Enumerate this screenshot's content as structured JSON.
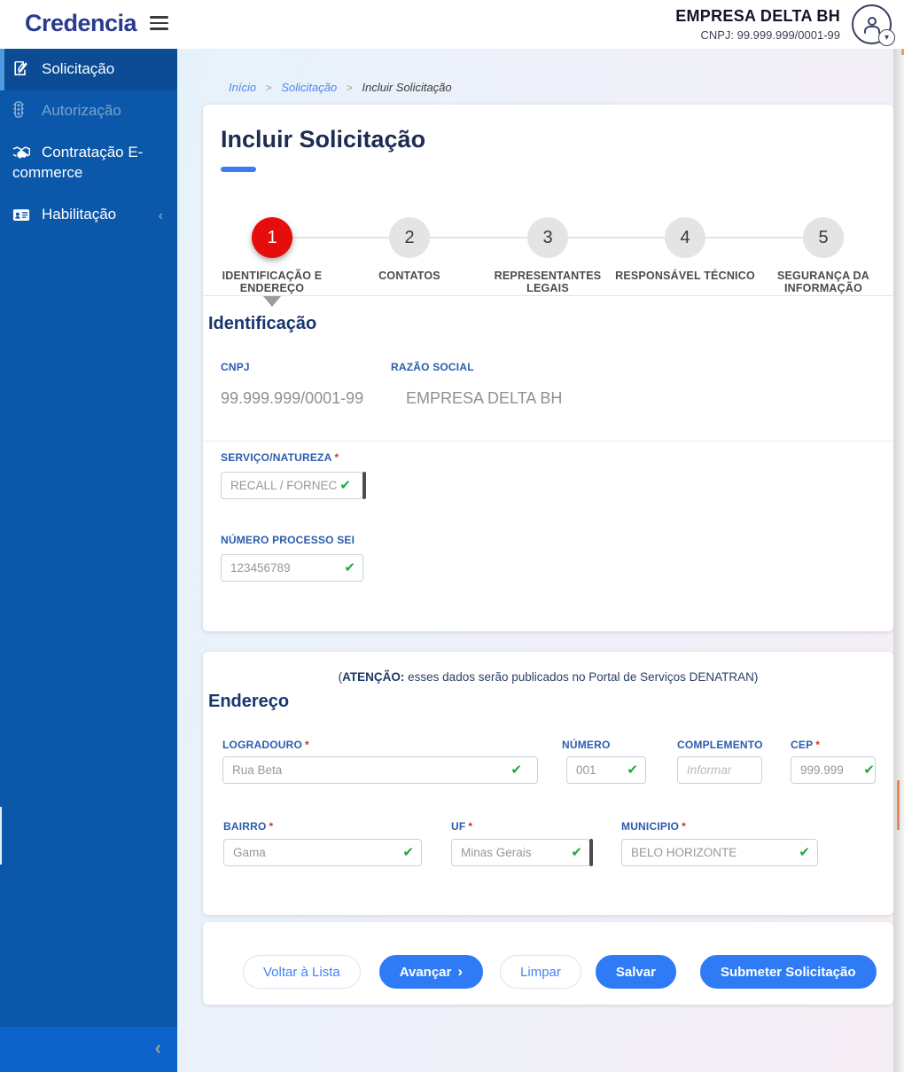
{
  "header": {
    "logo": "Credencia",
    "company_name": "EMPRESA DELTA BH",
    "company_cnpj": "CNPJ: 99.999.999/0001-99"
  },
  "sidebar": {
    "items": [
      {
        "label": "Solicitação",
        "state": "active"
      },
      {
        "label": "Autorização",
        "state": "disabled"
      },
      {
        "label": "Contratação E-commerce",
        "state": "normal"
      },
      {
        "label": "Habilitação",
        "state": "normal"
      }
    ]
  },
  "breadcrumb": {
    "items": [
      "Início",
      "Solicitação",
      "Incluir Solicitação"
    ],
    "separator": ">"
  },
  "page": {
    "title": "Incluir Solicitação"
  },
  "stepper": {
    "steps": [
      {
        "number": "1",
        "label": "IDENTIFICAÇÃO E ENDEREÇO",
        "active": true
      },
      {
        "number": "2",
        "label": "CONTATOS",
        "active": false
      },
      {
        "number": "3",
        "label": "REPRESENTANTES LEGAIS",
        "active": false
      },
      {
        "number": "4",
        "label": "RESPONSÁVEL TÉCNICO",
        "active": false
      },
      {
        "number": "5",
        "label": "SEGURANÇA DA INFORMAÇÃO",
        "active": false
      }
    ]
  },
  "identification": {
    "heading": "Identificação",
    "cnpj_label": "CNPJ",
    "cnpj_value": "99.999.999/0001-99",
    "razao_label": "RAZÃO SOCIAL",
    "razao_value": "EMPRESA DELTA BH",
    "servico_label": "SERVIÇO/NATUREZA",
    "servico_required": "*",
    "servico_value": "RECALL / FORNEC",
    "processo_label": "NÚMERO PROCESSO SEI",
    "processo_value": "123456789"
  },
  "address": {
    "note_prefix": "(",
    "note_bold": "ATENÇÃO:",
    "note_rest": " esses dados serão publicados no Portal de Serviços DENATRAN)",
    "heading": "Endereço",
    "required_mark": "*",
    "logradouro_label": "LOGRADOURO",
    "logradouro_value": "Rua Beta",
    "numero_label": "NÚMERO",
    "numero_value": "001",
    "complemento_label": "COMPLEMENTO",
    "complemento_placeholder": "Informar",
    "cep_label": "CEP",
    "cep_value": "999.999",
    "bairro_label": "BAIRRO",
    "bairro_value": "Gama",
    "uf_label": "UF",
    "uf_value": "Minas Gerais",
    "municipio_label": "MUNICIPIO",
    "municipio_value": "BELO HORIZONTE"
  },
  "actions": {
    "voltar": "Voltar à Lista",
    "avancar": "Avançar",
    "limpar": "Limpar",
    "salvar": "Salvar",
    "submeter": "Submeter Solicitação"
  },
  "icons": {
    "check": "✔",
    "chevron_right": "›",
    "chevron_left": "‹",
    "caret_down": "▾"
  },
  "colors": {
    "sidebar_blue": "#0b57a9",
    "active_item_blue": "#0b4c94",
    "accent_blue": "#2f7bf6",
    "logo_indigo": "#2b3a90",
    "step_active_red": "#e60d0d",
    "check_green": "#21a73c",
    "label_blue": "#2b5cad",
    "heading_navy": "#17366e"
  }
}
